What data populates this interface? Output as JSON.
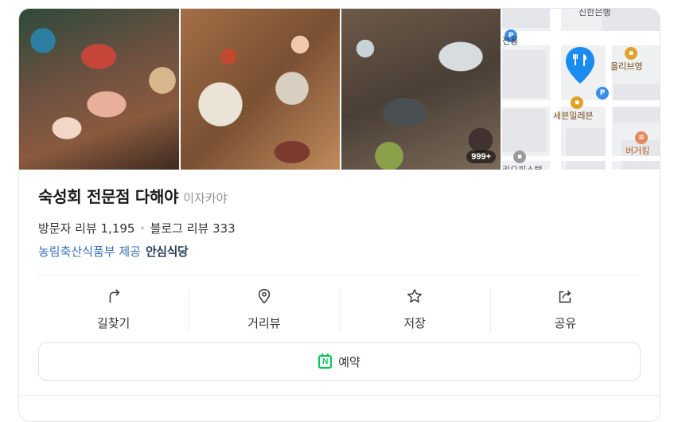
{
  "photos": {
    "count_badge": "999+"
  },
  "map": {
    "labels": {
      "top_partial": "신한은행",
      "bus_stop": "전용",
      "olive": "올리브영",
      "seven": "세븐일레븐",
      "burger": "버거킹",
      "bottom_partial": "리오피스텔"
    },
    "pin_color": "#1a8cf0"
  },
  "place": {
    "name": "숙성회 전문점 다해야",
    "category": "이자카야"
  },
  "reviews": {
    "visitor": "방문자 리뷰 1,195",
    "blog": "블로그 리뷰 333"
  },
  "provider": {
    "text": "농림축산식품부 제공",
    "badge": "안심식당"
  },
  "actions": {
    "directions": "길찾기",
    "street_view": "거리뷰",
    "save": "저장",
    "share": "공유"
  },
  "reserve": {
    "label": "예약",
    "icon_letter": "N"
  },
  "colors": {
    "link": "#3a6fb8",
    "naver_green": "#03c75a"
  }
}
